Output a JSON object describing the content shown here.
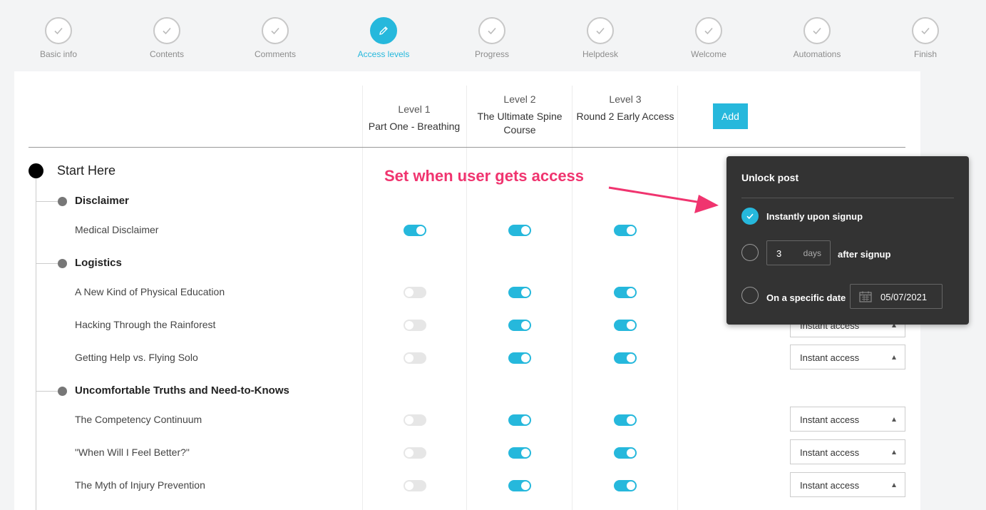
{
  "stepper": {
    "steps": [
      {
        "label": "Basic info",
        "icon": "check-icon",
        "active": false
      },
      {
        "label": "Contents",
        "icon": "check-icon",
        "active": false
      },
      {
        "label": "Comments",
        "icon": "check-icon",
        "active": false
      },
      {
        "label": "Access levels",
        "icon": "pencil-icon",
        "active": true
      },
      {
        "label": "Progress",
        "icon": "check-icon",
        "active": false
      },
      {
        "label": "Helpdesk",
        "icon": "check-icon",
        "active": false
      },
      {
        "label": "Welcome",
        "icon": "check-icon",
        "active": false
      },
      {
        "label": "Automations",
        "icon": "check-icon",
        "active": false
      },
      {
        "label": "Finish",
        "icon": "check-icon",
        "active": false
      }
    ]
  },
  "levels": [
    {
      "level": "Level 1",
      "name": "Part One - Breathing"
    },
    {
      "level": "Level 2",
      "name": "The Ultimate Spine Course"
    },
    {
      "level": "Level 3",
      "name": "Round 2 Early Access"
    }
  ],
  "add_label": "Add",
  "root_title": "Start Here",
  "sections": [
    {
      "title": "Disclaimer",
      "items": [
        {
          "title": "Medical Disclaimer",
          "toggles": [
            true,
            true,
            true
          ],
          "access": ""
        }
      ]
    },
    {
      "title": "Logistics",
      "items": [
        {
          "title": "A New Kind of Physical Education",
          "toggles": [
            false,
            true,
            true
          ],
          "access": ""
        },
        {
          "title": "Hacking Through the Rainforest",
          "toggles": [
            false,
            true,
            true
          ],
          "access": "Instant access"
        },
        {
          "title": "Getting Help vs. Flying Solo",
          "toggles": [
            false,
            true,
            true
          ],
          "access": "Instant access"
        }
      ]
    },
    {
      "title": "Uncomfortable Truths and Need-to-Knows",
      "items": [
        {
          "title": "The Competency Continuum",
          "toggles": [
            false,
            true,
            true
          ],
          "access": "Instant access"
        },
        {
          "title": "\"When Will I Feel Better?\"",
          "toggles": [
            false,
            true,
            true
          ],
          "access": "Instant access"
        },
        {
          "title": "The Myth of Injury Prevention",
          "toggles": [
            false,
            true,
            true
          ],
          "access": "Instant access"
        }
      ]
    }
  ],
  "annotation": "Set when user gets access",
  "popup": {
    "title": "Unlock post",
    "option_instant": "Instantly upon signup",
    "days_value": "3",
    "days_unit": "days",
    "after_signup": "after signup",
    "option_date": "On a specific date",
    "date_value": "05/07/2021",
    "selected": "instant"
  },
  "colors": {
    "accent": "#26b8dc",
    "annotation": "#f0346f",
    "popup_bg": "#333333"
  }
}
